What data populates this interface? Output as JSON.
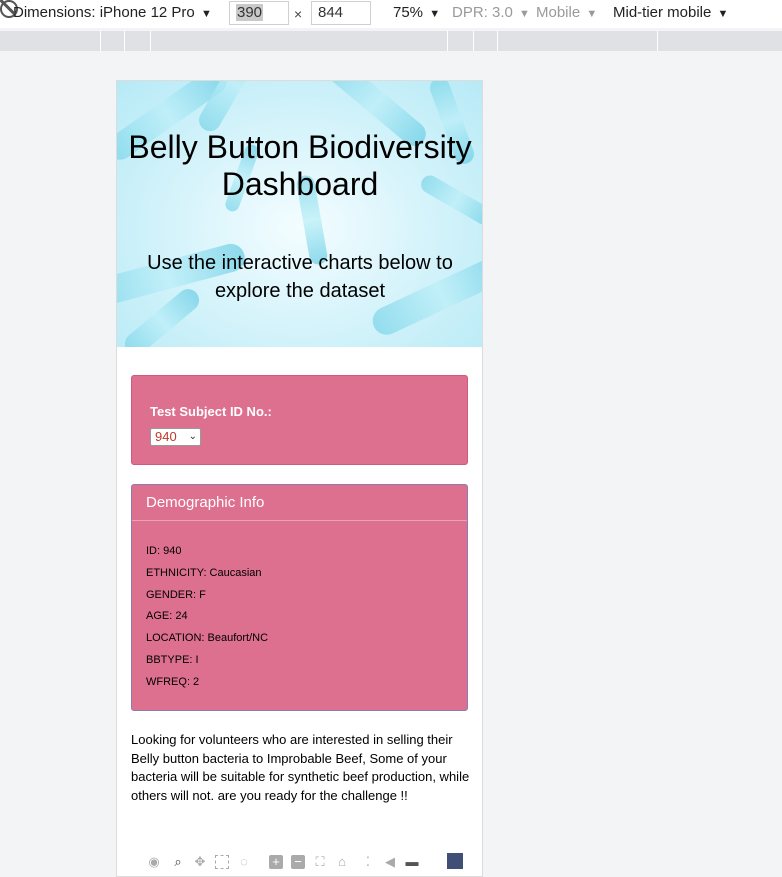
{
  "devtools": {
    "dimensions_label": "Dimensions: iPhone 12 Pro",
    "width_value": "390",
    "times": "×",
    "height_value": "844",
    "zoom": "75%",
    "dpr": "DPR: 3.0",
    "mode": "Mobile",
    "throttle": "Mid-tier mobile",
    "caret": "▼"
  },
  "page": {
    "title": "Belly Button Biodiversity Dashboard",
    "subtitle": "Use the interactive charts below to explore the dataset",
    "selector_label": "Test Subject ID No.:",
    "selected_id": "940",
    "demographic_title": "Demographic Info",
    "demographics": [
      "ID: 940",
      "ETHNICITY: Caucasian",
      "GENDER: F",
      "AGE: 24",
      "LOCATION: Beaufort/NC",
      "BBTYPE: I",
      "WFREQ: 2"
    ],
    "blurb": "Looking for volunteers who are interested in selling their Belly button bacteria to Improbable Beef, Some of your bacteria will be suitable for synthetic beef production, while others will not. are you ready for the challenge !!"
  },
  "modebar_icons": [
    "camera-icon",
    "zoom-icon",
    "pan-icon",
    "box-select-icon",
    "lasso-icon",
    "zoom-in-icon",
    "zoom-out-icon",
    "autoscale-icon",
    "reset-axes-icon",
    "spike-lines-icon",
    "hover-closest-icon",
    "hover-compare-icon",
    "plotly-logo-icon"
  ]
}
